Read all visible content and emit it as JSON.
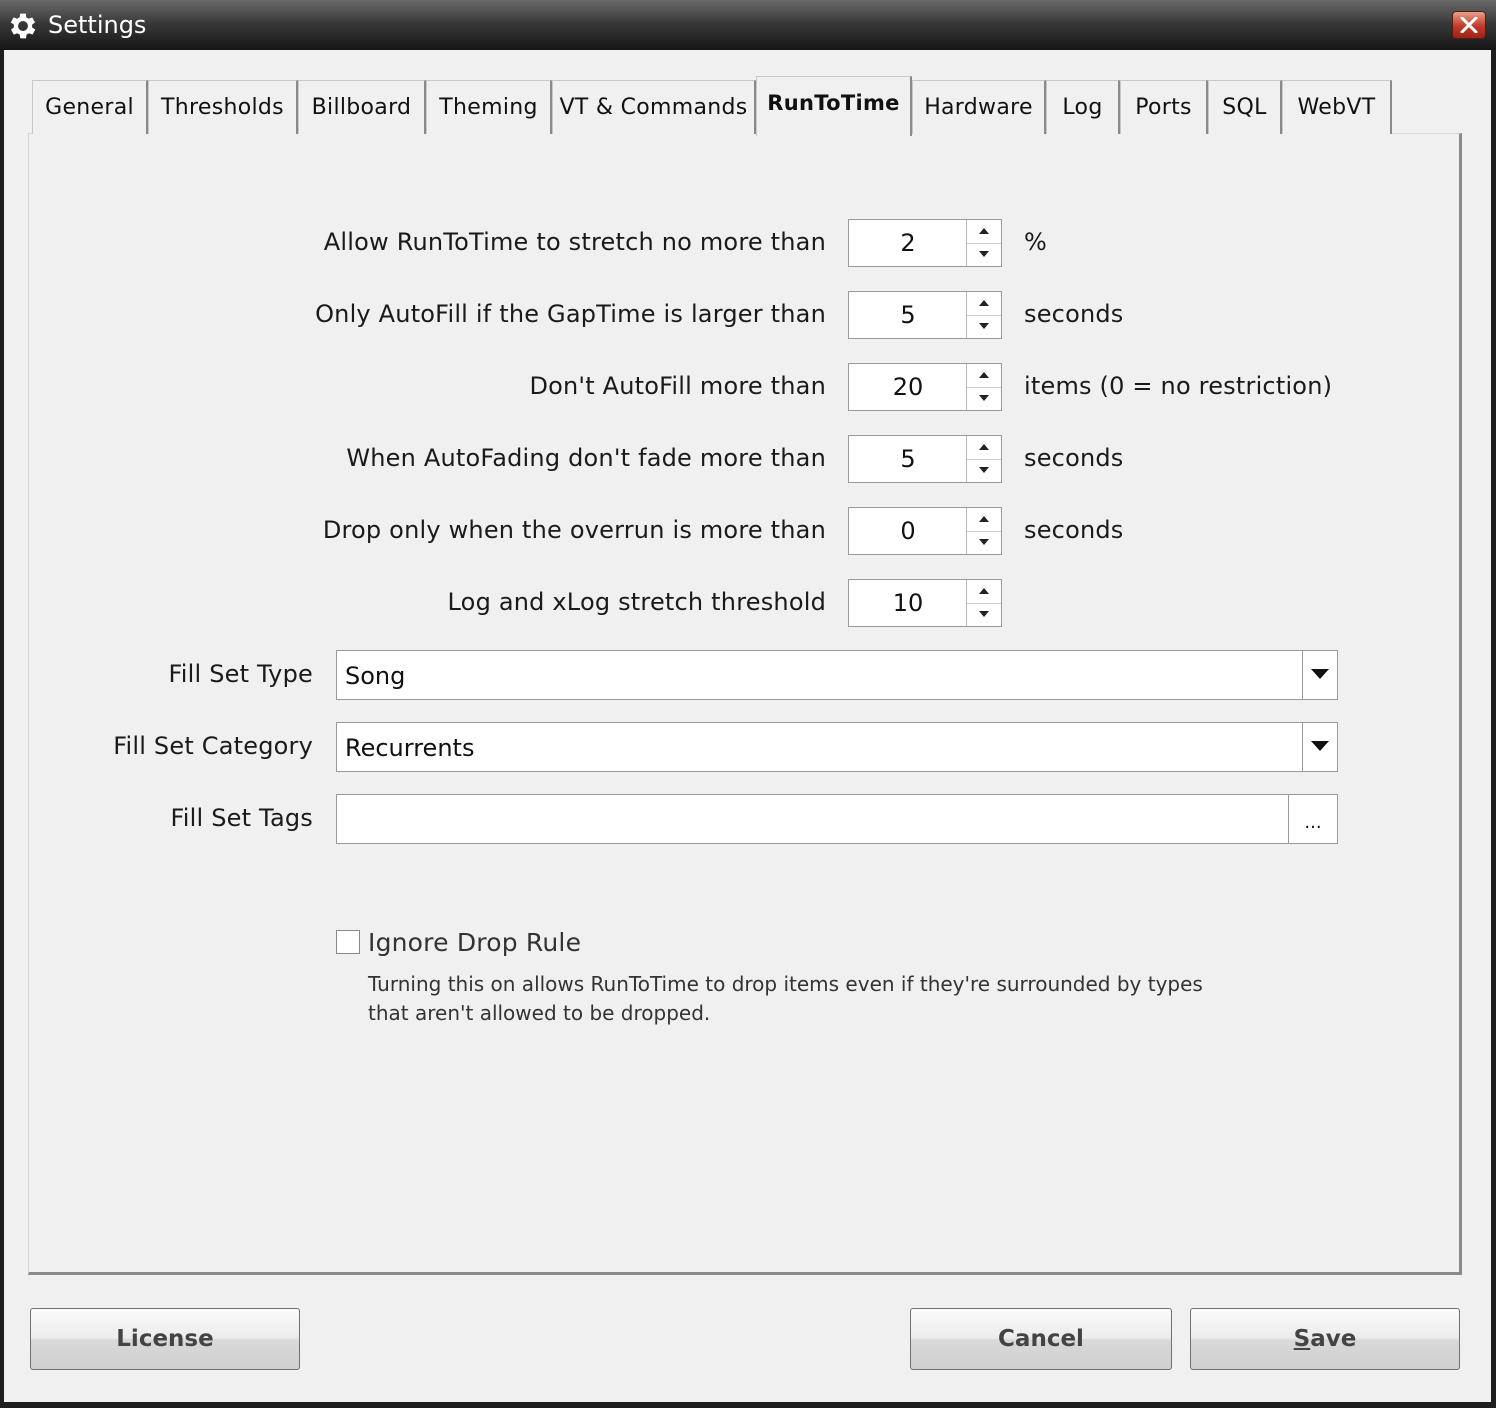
{
  "window": {
    "title": "Settings"
  },
  "tabs": [
    {
      "label": "General"
    },
    {
      "label": "Thresholds"
    },
    {
      "label": "Billboard"
    },
    {
      "label": "Theming"
    },
    {
      "label": "VT & Commands"
    },
    {
      "label": "RunToTime"
    },
    {
      "label": "Hardware"
    },
    {
      "label": "Log"
    },
    {
      "label": "Ports"
    },
    {
      "label": "SQL"
    },
    {
      "label": "WebVT"
    }
  ],
  "active_tab": "RunToTime",
  "settings": [
    {
      "label": "Allow RunToTime to stretch no more than",
      "value": "2",
      "unit": "%"
    },
    {
      "label": "Only AutoFill if the GapTime is larger than",
      "value": "5",
      "unit": "seconds"
    },
    {
      "label": "Don't AutoFill more than",
      "value": "20",
      "unit": "items (0 = no restriction)"
    },
    {
      "label": "When AutoFading don't fade more than",
      "value": "5",
      "unit": "seconds"
    },
    {
      "label": "Drop only when the overrun is more than",
      "value": "0",
      "unit": "seconds"
    },
    {
      "label": "Log and xLog stretch threshold",
      "value": "10",
      "unit": ""
    }
  ],
  "fill_set_type": {
    "label": "Fill Set Type",
    "value": "Song"
  },
  "fill_set_category": {
    "label": "Fill Set Category",
    "value": "Recurrents"
  },
  "fill_set_tags": {
    "label": "Fill Set Tags",
    "value": "",
    "button": "..."
  },
  "ignore_drop_rule": {
    "label": "Ignore Drop Rule",
    "checked": false,
    "description": "Turning this on allows RunToTime to drop items even if they're surrounded by types that aren't allowed to be dropped."
  },
  "buttons": {
    "license": "License",
    "cancel": "Cancel",
    "save_first": "S",
    "save_rest": "ave"
  }
}
